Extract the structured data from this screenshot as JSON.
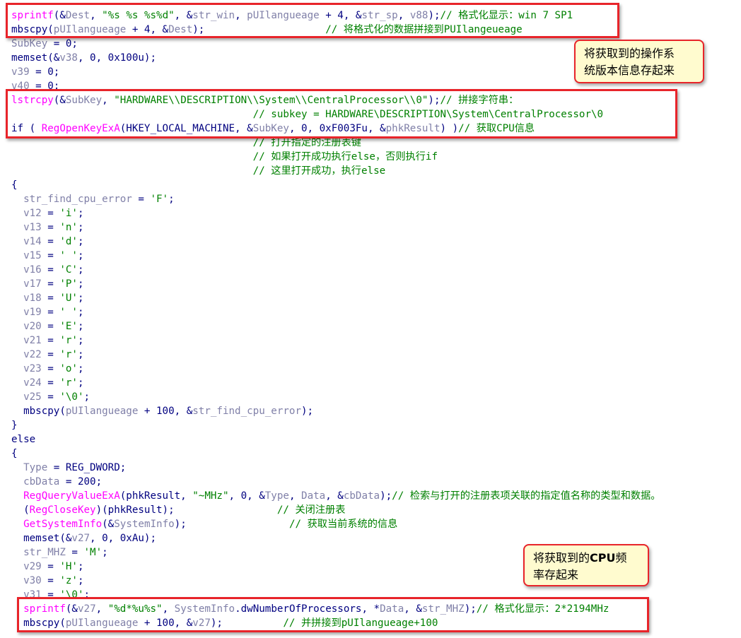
{
  "colors": {
    "keyword": "#000080",
    "function": "#ff00ff",
    "variable": "#8080a8",
    "string": "#008000",
    "comment": "#008000",
    "highlight_border": "#e8242a",
    "note_background": "#fffbcf"
  },
  "annotations": {
    "os_version_note": "将获取到的操作系\n统版本信息存起来",
    "cpu_freq_note_part1": "将获取到的",
    "cpu_freq_note_bold": "CPU",
    "cpu_freq_note_part2": "频\n率存起来"
  },
  "code_lines": [
    [
      [
        "t-func",
        "sprintf"
      ],
      [
        "t-plain",
        "(&"
      ],
      [
        "t-var",
        "Dest"
      ],
      [
        "t-plain",
        ", "
      ],
      [
        "t-str",
        "\"%s %s %s%d\""
      ],
      [
        "t-plain",
        ", &"
      ],
      [
        "t-var",
        "str_win"
      ],
      [
        "t-plain",
        ", "
      ],
      [
        "t-var",
        "pUIlangueage"
      ],
      [
        "t-plain",
        " + 4, &"
      ],
      [
        "t-var",
        "str_sp"
      ],
      [
        "t-plain",
        ", "
      ],
      [
        "t-var",
        "v88"
      ],
      [
        "t-plain",
        ");"
      ],
      [
        "t-com",
        "// 格式化显示：win 7 SP1"
      ]
    ],
    [
      [
        "t-plain",
        "mbscpy("
      ],
      [
        "t-var",
        "pUIlangueage"
      ],
      [
        "t-plain",
        " + 4, &"
      ],
      [
        "t-var",
        "Dest"
      ],
      [
        "t-plain",
        ");                    "
      ],
      [
        "t-com",
        "// 将格式化的数据拼接到PUIlangeueage"
      ]
    ],
    [
      [
        "t-var",
        "SubKey"
      ],
      [
        "t-plain",
        " = 0;"
      ]
    ],
    [
      [
        "t-plain",
        "memset(&"
      ],
      [
        "t-var",
        "v38"
      ],
      [
        "t-plain",
        ", 0, 0x100u);"
      ]
    ],
    [
      [
        "t-var",
        "v39"
      ],
      [
        "t-plain",
        " = 0;"
      ]
    ],
    [
      [
        "t-var",
        "v40"
      ],
      [
        "t-plain",
        " = 0;"
      ]
    ],
    [
      [
        "t-func",
        "lstrcpy"
      ],
      [
        "t-plain",
        "(&"
      ],
      [
        "t-var",
        "SubKey"
      ],
      [
        "t-plain",
        ", "
      ],
      [
        "t-str",
        "\"HARDWARE\\\\DESCRIPTION\\\\System\\\\CentralProcessor\\\\0\""
      ],
      [
        "t-plain",
        ");"
      ],
      [
        "t-com",
        "// 拼接字符串："
      ]
    ],
    [
      [
        "t-plain",
        "                                        "
      ],
      [
        "t-com",
        "// subkey = HARDWARE\\DESCRIPTION\\System\\CentralProcessor\\0"
      ]
    ],
    [
      [
        "t-plain",
        "if ( "
      ],
      [
        "t-func",
        "RegOpenKeyExA"
      ],
      [
        "t-plain",
        "(HKEY_LOCAL_MACHINE, &"
      ],
      [
        "t-var",
        "SubKey"
      ],
      [
        "t-plain",
        ", 0, 0xF003Fu, &"
      ],
      [
        "t-var",
        "phkResult"
      ],
      [
        "t-plain",
        ") )"
      ],
      [
        "t-com",
        "// 获取CPU信息"
      ]
    ],
    [
      [
        "t-plain",
        "                                        "
      ],
      [
        "t-com",
        "// 打开指定的注册表键"
      ]
    ],
    [
      [
        "t-plain",
        "                                        "
      ],
      [
        "t-com",
        "// 如果打开成功执行else，否则执行if"
      ]
    ],
    [
      [
        "t-plain",
        "                                        "
      ],
      [
        "t-com",
        "// 这里打开成功，执行else"
      ]
    ],
    [
      [
        "t-plain",
        "{"
      ]
    ],
    [
      [
        "t-plain",
        "  "
      ],
      [
        "t-var",
        "str_find_cpu_error"
      ],
      [
        "t-plain",
        " = "
      ],
      [
        "t-str",
        "'F'"
      ],
      [
        "t-plain",
        ";"
      ]
    ],
    [
      [
        "t-plain",
        "  "
      ],
      [
        "t-var",
        "v12"
      ],
      [
        "t-plain",
        " = "
      ],
      [
        "t-str",
        "'i'"
      ],
      [
        "t-plain",
        ";"
      ]
    ],
    [
      [
        "t-plain",
        "  "
      ],
      [
        "t-var",
        "v13"
      ],
      [
        "t-plain",
        " = "
      ],
      [
        "t-str",
        "'n'"
      ],
      [
        "t-plain",
        ";"
      ]
    ],
    [
      [
        "t-plain",
        "  "
      ],
      [
        "t-var",
        "v14"
      ],
      [
        "t-plain",
        " = "
      ],
      [
        "t-str",
        "'d'"
      ],
      [
        "t-plain",
        ";"
      ]
    ],
    [
      [
        "t-plain",
        "  "
      ],
      [
        "t-var",
        "v15"
      ],
      [
        "t-plain",
        " = "
      ],
      [
        "t-str",
        "' '"
      ],
      [
        "t-plain",
        ";"
      ]
    ],
    [
      [
        "t-plain",
        "  "
      ],
      [
        "t-var",
        "v16"
      ],
      [
        "t-plain",
        " = "
      ],
      [
        "t-str",
        "'C'"
      ],
      [
        "t-plain",
        ";"
      ]
    ],
    [
      [
        "t-plain",
        "  "
      ],
      [
        "t-var",
        "v17"
      ],
      [
        "t-plain",
        " = "
      ],
      [
        "t-str",
        "'P'"
      ],
      [
        "t-plain",
        ";"
      ]
    ],
    [
      [
        "t-plain",
        "  "
      ],
      [
        "t-var",
        "v18"
      ],
      [
        "t-plain",
        " = "
      ],
      [
        "t-str",
        "'U'"
      ],
      [
        "t-plain",
        ";"
      ]
    ],
    [
      [
        "t-plain",
        "  "
      ],
      [
        "t-var",
        "v19"
      ],
      [
        "t-plain",
        " = "
      ],
      [
        "t-str",
        "' '"
      ],
      [
        "t-plain",
        ";"
      ]
    ],
    [
      [
        "t-plain",
        "  "
      ],
      [
        "t-var",
        "v20"
      ],
      [
        "t-plain",
        " = "
      ],
      [
        "t-str",
        "'E'"
      ],
      [
        "t-plain",
        ";"
      ]
    ],
    [
      [
        "t-plain",
        "  "
      ],
      [
        "t-var",
        "v21"
      ],
      [
        "t-plain",
        " = "
      ],
      [
        "t-str",
        "'r'"
      ],
      [
        "t-plain",
        ";"
      ]
    ],
    [
      [
        "t-plain",
        "  "
      ],
      [
        "t-var",
        "v22"
      ],
      [
        "t-plain",
        " = "
      ],
      [
        "t-str",
        "'r'"
      ],
      [
        "t-plain",
        ";"
      ]
    ],
    [
      [
        "t-plain",
        "  "
      ],
      [
        "t-var",
        "v23"
      ],
      [
        "t-plain",
        " = "
      ],
      [
        "t-str",
        "'o'"
      ],
      [
        "t-plain",
        ";"
      ]
    ],
    [
      [
        "t-plain",
        "  "
      ],
      [
        "t-var",
        "v24"
      ],
      [
        "t-plain",
        " = "
      ],
      [
        "t-str",
        "'r'"
      ],
      [
        "t-plain",
        ";"
      ]
    ],
    [
      [
        "t-plain",
        "  "
      ],
      [
        "t-var",
        "v25"
      ],
      [
        "t-plain",
        " = "
      ],
      [
        "t-str",
        "'\\0'"
      ],
      [
        "t-plain",
        ";"
      ]
    ],
    [
      [
        "t-plain",
        "  mbscpy("
      ],
      [
        "t-var",
        "pUIlangueage"
      ],
      [
        "t-plain",
        " + 100, &"
      ],
      [
        "t-var",
        "str_find_cpu_error"
      ],
      [
        "t-plain",
        ");"
      ]
    ],
    [
      [
        "t-plain",
        "}"
      ]
    ],
    [
      [
        "t-plain",
        "else"
      ]
    ],
    [
      [
        "t-plain",
        "{"
      ]
    ],
    [
      [
        "t-plain",
        "  "
      ],
      [
        "t-var",
        "Type"
      ],
      [
        "t-plain",
        " = REG_DWORD;"
      ]
    ],
    [
      [
        "t-plain",
        "  "
      ],
      [
        "t-var",
        "cbData"
      ],
      [
        "t-plain",
        " = 200;"
      ]
    ],
    [
      [
        "t-plain",
        "  "
      ],
      [
        "t-func",
        "RegQueryValueExA"
      ],
      [
        "t-plain",
        "(phkResult, "
      ],
      [
        "t-str",
        "\"~MHz\""
      ],
      [
        "t-plain",
        ", 0, &"
      ],
      [
        "t-var",
        "Type"
      ],
      [
        "t-plain",
        ", "
      ],
      [
        "t-var",
        "Data"
      ],
      [
        "t-plain",
        ", &"
      ],
      [
        "t-var",
        "cbData"
      ],
      [
        "t-plain",
        ");"
      ],
      [
        "t-com",
        "// 检索与打开的注册表项关联的指定值名称的类型和数据。"
      ]
    ],
    [
      [
        "t-plain",
        "  ("
      ],
      [
        "t-func",
        "RegCloseKey"
      ],
      [
        "t-plain",
        ")(phkResult);                 "
      ],
      [
        "t-com",
        "// 关闭注册表"
      ]
    ],
    [
      [
        "t-plain",
        "  "
      ],
      [
        "t-func",
        "GetSystemInfo"
      ],
      [
        "t-plain",
        "(&"
      ],
      [
        "t-var",
        "SystemInfo"
      ],
      [
        "t-plain",
        ");                 "
      ],
      [
        "t-com",
        "// 获取当前系统的信息"
      ]
    ],
    [
      [
        "t-plain",
        "  memset(&"
      ],
      [
        "t-var",
        "v27"
      ],
      [
        "t-plain",
        ", 0, 0xAu);"
      ]
    ],
    [
      [
        "t-plain",
        "  "
      ],
      [
        "t-var",
        "str_MHZ"
      ],
      [
        "t-plain",
        " = "
      ],
      [
        "t-str",
        "'M'"
      ],
      [
        "t-plain",
        ";"
      ]
    ],
    [
      [
        "t-plain",
        "  "
      ],
      [
        "t-var",
        "v29"
      ],
      [
        "t-plain",
        " = "
      ],
      [
        "t-str",
        "'H'"
      ],
      [
        "t-plain",
        ";"
      ]
    ],
    [
      [
        "t-plain",
        "  "
      ],
      [
        "t-var",
        "v30"
      ],
      [
        "t-plain",
        " = "
      ],
      [
        "t-str",
        "'z'"
      ],
      [
        "t-plain",
        ";"
      ]
    ],
    [
      [
        "t-plain",
        "  "
      ],
      [
        "t-var",
        "v31"
      ],
      [
        "t-plain",
        " = "
      ],
      [
        "t-str",
        "'\\0'"
      ],
      [
        "t-plain",
        ";"
      ]
    ],
    [
      [
        "t-plain",
        "  "
      ],
      [
        "t-func",
        "sprintf"
      ],
      [
        "t-plain",
        "(&"
      ],
      [
        "t-var",
        "v27"
      ],
      [
        "t-plain",
        ", "
      ],
      [
        "t-str",
        "\"%d*%u%s\""
      ],
      [
        "t-plain",
        ", "
      ],
      [
        "t-var",
        "SystemInfo"
      ],
      [
        "t-plain",
        ".dwNumberOfProcessors, *"
      ],
      [
        "t-var",
        "Data"
      ],
      [
        "t-plain",
        ", &"
      ],
      [
        "t-var",
        "str_MHZ"
      ],
      [
        "t-plain",
        ");"
      ],
      [
        "t-com",
        "// 格式化显示：2*2194MHz"
      ]
    ],
    [
      [
        "t-plain",
        "  mbscpy("
      ],
      [
        "t-var",
        "pUIlangueage"
      ],
      [
        "t-plain",
        " + 100, &"
      ],
      [
        "t-var",
        "v27"
      ],
      [
        "t-plain",
        ");          "
      ],
      [
        "t-com",
        "// 并拼接到pUIlangueage+100"
      ]
    ]
  ]
}
